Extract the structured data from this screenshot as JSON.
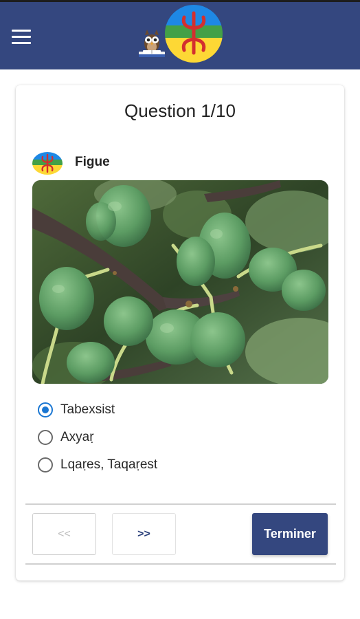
{
  "header": {
    "menu_icon": "hamburger-menu-icon",
    "logo_icon": "owl-reading-icon",
    "flag_icon": "amazigh-flag-icon"
  },
  "quiz": {
    "title": "Question 1/10",
    "word": "Figue",
    "word_flag_icon": "amazigh-flag-icon",
    "image_subject": "figs-on-branch-photo",
    "options": [
      {
        "label": "Tabexsist",
        "selected": true
      },
      {
        "label": "Axyaṛ",
        "selected": false
      },
      {
        "label": "Lqaṛes, Taqaṛest",
        "selected": false
      }
    ]
  },
  "nav": {
    "prev_label": "<<",
    "next_label": ">>",
    "finish_label": "Terminer"
  },
  "colors": {
    "primary": "#34477f",
    "radio_active": "#1976d2",
    "flag_blue": "#1e88e5",
    "flag_green": "#43a047",
    "flag_yellow": "#fdd835",
    "flag_red": "#d32f2f"
  }
}
